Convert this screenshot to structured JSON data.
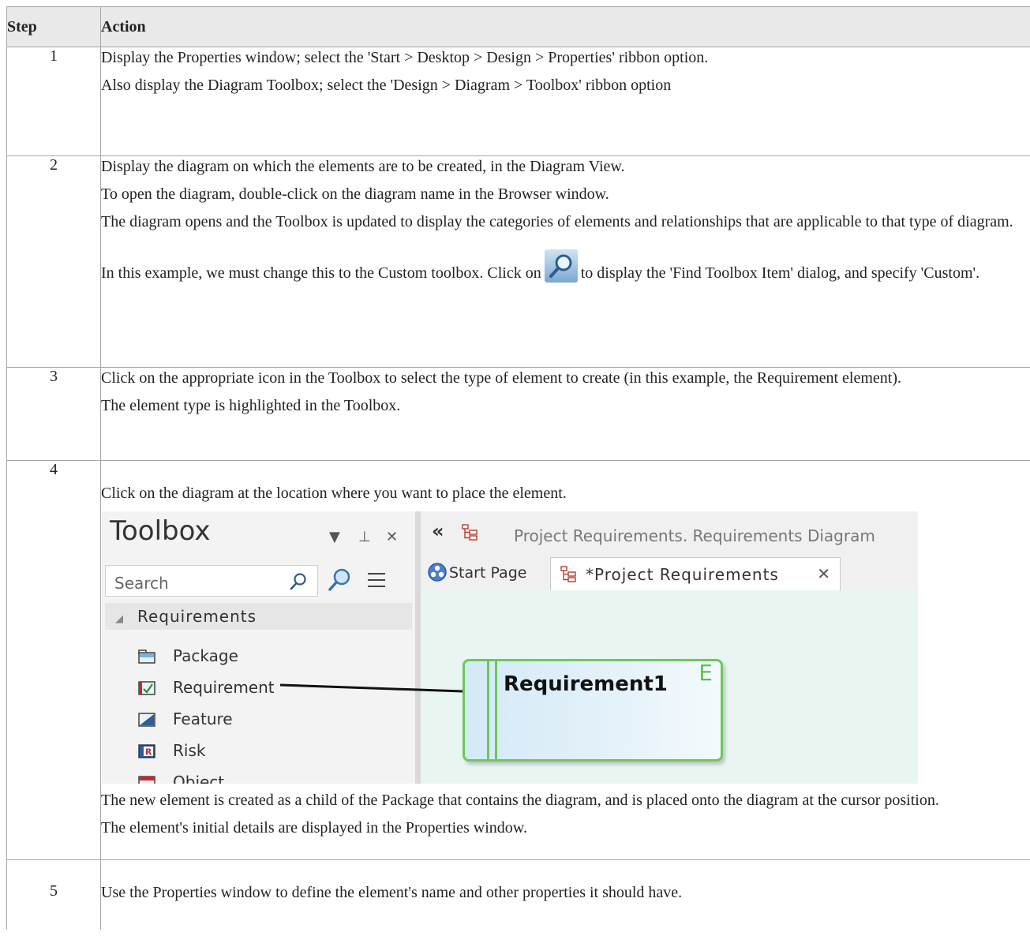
{
  "table": {
    "headers": {
      "step": "Step",
      "action": "Action"
    },
    "rows": [
      {
        "step": "1",
        "paragraphs": [
          "Display the Properties window; select the 'Start > Desktop > Design > Properties' ribbon option.",
          "Also display the Diagram Toolbox; select the 'Design > Diagram > Toolbox' ribbon option"
        ]
      },
      {
        "step": "2",
        "paragraphs": [
          "Display the diagram on which the elements are to be created, in the Diagram View.",
          "To open the diagram, double-click on the diagram name in the Browser window.",
          "The diagram opens and the Toolbox is updated to display the categories of elements and relationships that are applicable to that type of diagram."
        ],
        "icon_sentence": {
          "before": "In this example, we must change this to the Custom toolbox. Click on",
          "icon": "find-toolbox-icon",
          "after": "to display the 'Find Toolbox Item' dialog, and specify 'Custom'."
        }
      },
      {
        "step": "3",
        "paragraphs": [
          "Click on the appropriate icon in the Toolbox to select the type of element to create (in this example, the Requirement element).",
          "The element type is highlighted in the Toolbox."
        ]
      },
      {
        "step": "4",
        "before_image": "Click on the diagram at the location where you want to place the element.",
        "after_image": [
          "The new element is created as a child of the Package that contains the diagram, and is placed onto the diagram at the cursor position.",
          "The element's initial details are displayed in the Properties window."
        ]
      },
      {
        "step": "5",
        "paragraphs": [
          "Use the Properties window to define the element's name and other properties it should have."
        ]
      }
    ]
  },
  "screenshot": {
    "toolbox": {
      "title": "Toolbox",
      "controls": {
        "dropdown": "▼",
        "pin": "⊥",
        "close": "✕"
      },
      "search_placeholder": "Search",
      "category": "Requirements",
      "items": [
        {
          "label": "Package",
          "icon": "package-icon"
        },
        {
          "label": "Requirement",
          "icon": "requirement-icon"
        },
        {
          "label": "Feature",
          "icon": "feature-icon"
        },
        {
          "label": "Risk",
          "icon": "risk-icon"
        },
        {
          "label": "Object",
          "icon": "object-icon"
        }
      ]
    },
    "diagram": {
      "back": "«",
      "path": "Project Requirements.  Requirements Diagram",
      "tabs": [
        {
          "label": "Start Page"
        },
        {
          "label": "*Project Requirements",
          "close": "✕"
        }
      ],
      "element": {
        "name": "Requirement1",
        "stereotype_marker": "E"
      }
    },
    "colors": {
      "element_border": "#6cc85a",
      "canvas": "#e8f5f1",
      "element_fill": "#d4e9f7"
    }
  }
}
